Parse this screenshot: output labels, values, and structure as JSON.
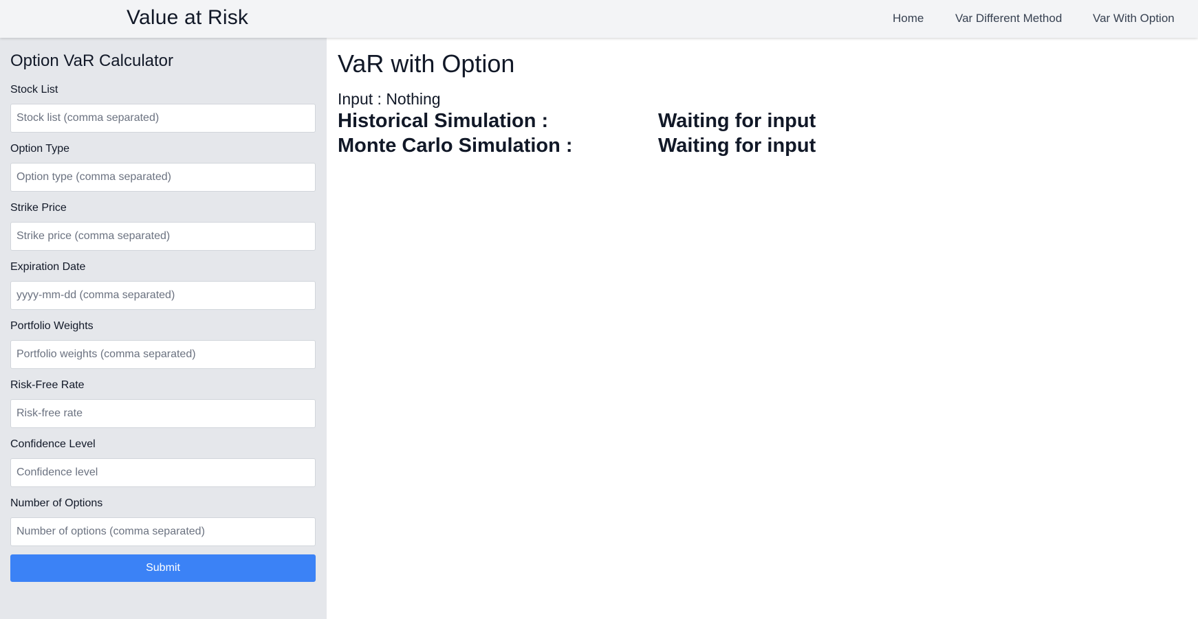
{
  "header": {
    "brand": "Value at Risk",
    "nav": [
      "Home",
      "Var Different Method",
      "Var With Option"
    ]
  },
  "sidebar": {
    "title": "Option VaR Calculator",
    "fields": [
      {
        "label": "Stock List",
        "placeholder": "Stock list (comma separated)",
        "value": ""
      },
      {
        "label": "Option Type",
        "placeholder": "Option type (comma separated)",
        "value": ""
      },
      {
        "label": "Strike Price",
        "placeholder": "Strike price (comma separated)",
        "value": ""
      },
      {
        "label": "Expiration Date",
        "placeholder": "yyyy-mm-dd (comma separated)",
        "value": ""
      },
      {
        "label": "Portfolio Weights",
        "placeholder": "Portfolio weights (comma separated)",
        "value": ""
      },
      {
        "label": "Risk-Free Rate",
        "placeholder": "Risk-free rate",
        "value": ""
      },
      {
        "label": "Confidence Level",
        "placeholder": "Confidence level",
        "value": ""
      },
      {
        "label": "Number of Options",
        "placeholder": "Number of options (comma separated)",
        "value": ""
      }
    ],
    "submit_label": "Submit"
  },
  "main": {
    "title": "VaR with Option",
    "input_line": "Input : Nothing",
    "results": [
      {
        "label": "Historical Simulation :",
        "value": "Waiting for input"
      },
      {
        "label": "Monte Carlo Simulation :",
        "value": "Waiting for input"
      }
    ]
  },
  "colors": {
    "navbar_bg": "#f3f4f6",
    "sidebar_bg": "#e5e7eb",
    "accent": "#3b82f6"
  }
}
